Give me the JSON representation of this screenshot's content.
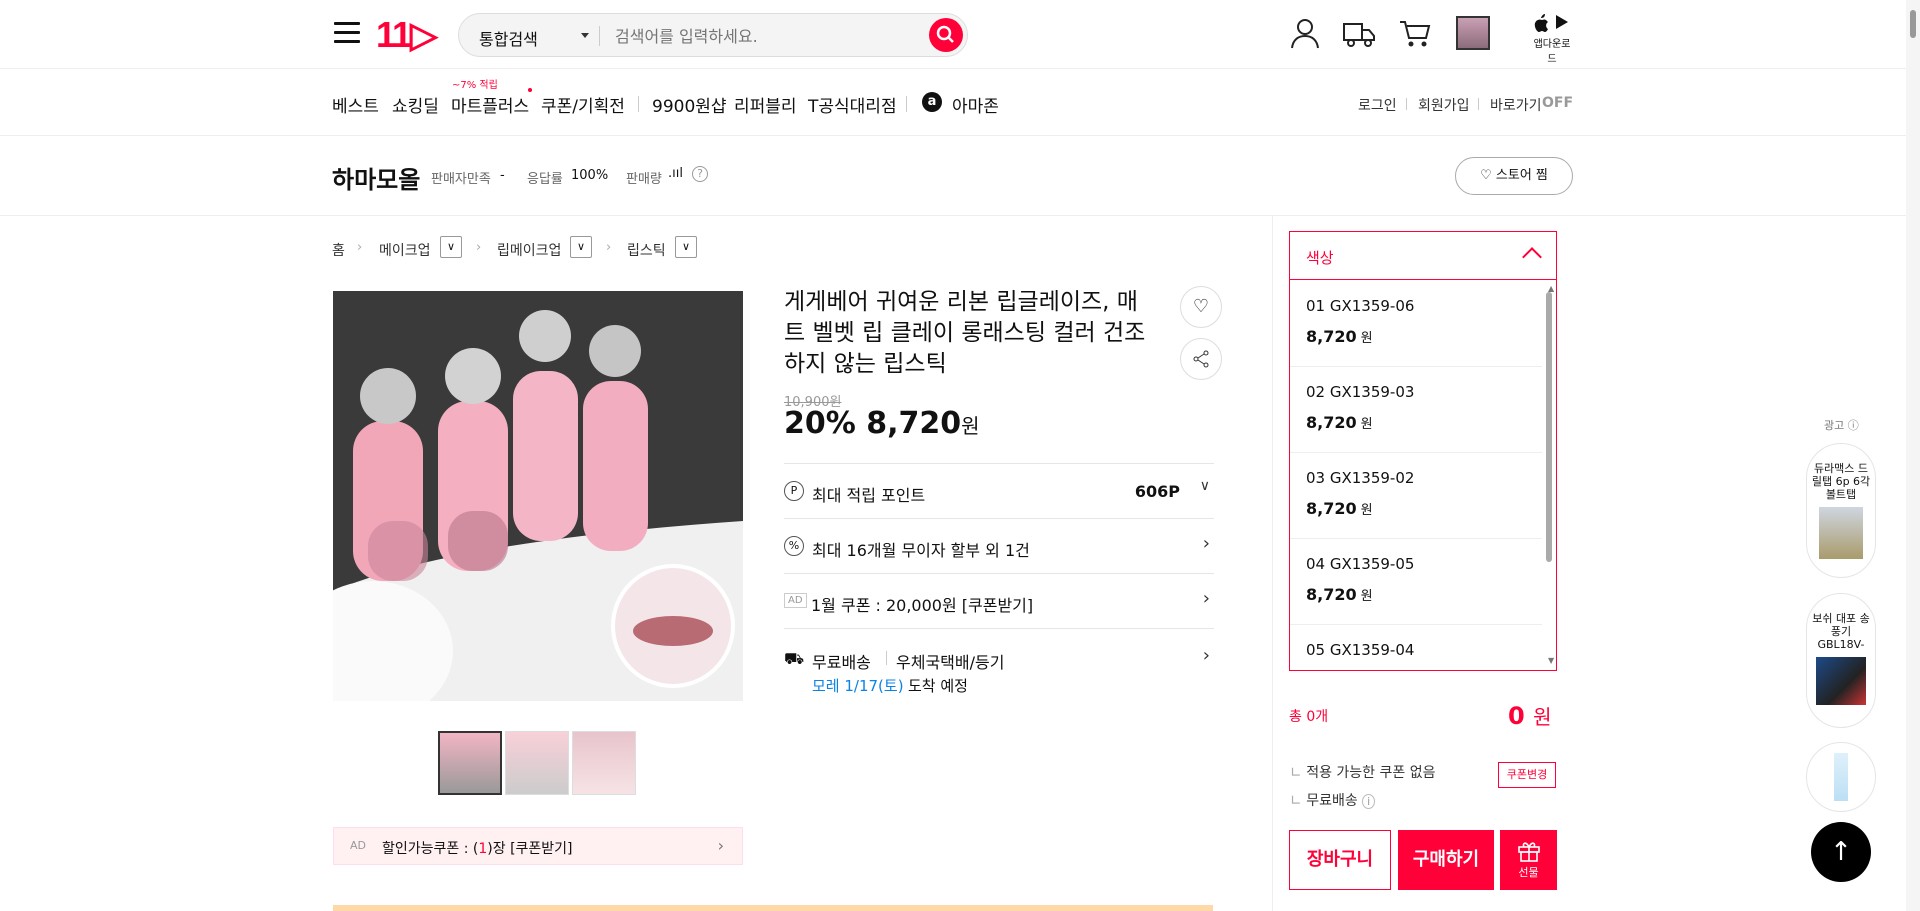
{
  "header": {
    "logo": "11▷",
    "search_category": "통합검색",
    "search_placeholder": "검색어를 입력하세요.",
    "app_download": "앱다운로드"
  },
  "nav": {
    "items": [
      "베스트",
      "쇼킹딜",
      "마트플러스",
      "쿠폰/기획전",
      "9900원샵",
      "리퍼블리",
      "T공식대리점",
      "아마존"
    ],
    "mart_badge": "~7% 적립",
    "login": "로그인",
    "signup": "회원가입",
    "quick": "바로가기",
    "quick_state": "OFF"
  },
  "store": {
    "name": "하마모올",
    "satisfaction_label": "판매자만족",
    "satisfaction_value": "-",
    "response_label": "응답률",
    "response_value": "100%",
    "sales_label": "판매량",
    "follow": "스토어 찜"
  },
  "breadcrumb": [
    "홈",
    "메이크업",
    "립메이크업",
    "립스틱"
  ],
  "product": {
    "title": "게게베어 귀여운 리본 립글레이즈, 매트 벨벳 립 클레이 롱래스팅 컬러 건조하지 않는 립스틱",
    "original_price": "10,900원",
    "discount": "20%",
    "price": "8,720",
    "price_unit": "원",
    "points_label": "최대 적립 포인트",
    "points_value": "606P",
    "installment": "최대 16개월 무이자 할부 외 1건",
    "coupon_ad": "AD",
    "coupon_text": "1월 쿠폰 : 20,000원 [쿠폰받기]",
    "shipping": "무료배송",
    "shipping_method": "우체국택배/등기",
    "arrival_date": "모레 1/17(토)",
    "arrival_suffix": "도착 예정",
    "discount_coupon_prefix": "할인가능쿠폰 : (",
    "discount_coupon_count": "1",
    "discount_coupon_suffix": ")장 [쿠폰받기]"
  },
  "options": {
    "label": "색상",
    "items": [
      {
        "name": "01 GX1359-06",
        "price": "8,720",
        "unit": "원"
      },
      {
        "name": "02 GX1359-03",
        "price": "8,720",
        "unit": "원"
      },
      {
        "name": "03 GX1359-02",
        "price": "8,720",
        "unit": "원"
      },
      {
        "name": "04 GX1359-05",
        "price": "8,720",
        "unit": "원"
      },
      {
        "name": "05 GX1359-04",
        "price": "",
        "unit": ""
      }
    ]
  },
  "order": {
    "total_label": "총 0개",
    "total_price": "0",
    "total_unit": "원",
    "coupon_none": "적용 가능한 쿠폰 없음",
    "coupon_change": "쿠폰변경",
    "free_ship": "무료배송",
    "cart": "장바구니",
    "buy": "구매하기",
    "gift": "선물"
  },
  "side_ads": {
    "label": "광고",
    "ad1": "듀라맥스 드릴탭 6p 6각 볼트탭",
    "ad2": "보쉬 대포 송풍기 GBL18V-"
  },
  "colors": {
    "brand": "#ff0038",
    "link_blue": "#0b83e6"
  }
}
